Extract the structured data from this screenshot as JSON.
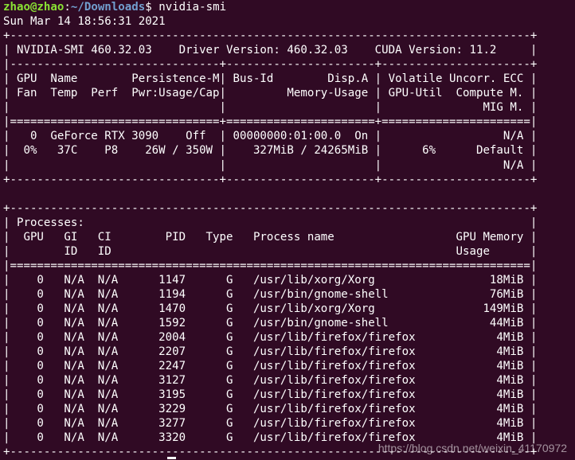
{
  "prompt": {
    "user_host": "zhao@zhao",
    "path": "~/Downloads",
    "symbol": "$",
    "command": "nvidia-smi"
  },
  "timestamp": "Sun Mar 14 18:56:31 2021",
  "output_lines": [
    "+-----------------------------------------------------------------------------+",
    "| NVIDIA-SMI 460.32.03    Driver Version: 460.32.03    CUDA Version: 11.2     |",
    "|-------------------------------+----------------------+----------------------+",
    "| GPU  Name        Persistence-M| Bus-Id        Disp.A | Volatile Uncorr. ECC |",
    "| Fan  Temp  Perf  Pwr:Usage/Cap|         Memory-Usage | GPU-Util  Compute M. |",
    "|                               |                      |               MIG M. |",
    "|===============================+======================+======================|",
    "|   0  GeForce RTX 3090    Off  | 00000000:01:00.0  On |                  N/A |",
    "|  0%   37C    P8    26W / 350W |    327MiB / 24265MiB |      6%      Default |",
    "|                               |                      |                  N/A |",
    "+-------------------------------+----------------------+----------------------+",
    "",
    "+-----------------------------------------------------------------------------+",
    "| Processes:                                                                  |",
    "|  GPU   GI   CI        PID   Type   Process name                  GPU Memory |",
    "|        ID   ID                                                   Usage      |",
    "|=============================================================================|",
    "|    0   N/A  N/A      1147      G   /usr/lib/xorg/Xorg                 18MiB |",
    "|    0   N/A  N/A      1194      G   /usr/bin/gnome-shell               76MiB |",
    "|    0   N/A  N/A      1470      G   /usr/lib/xorg/Xorg                149MiB |",
    "|    0   N/A  N/A      1592      G   /usr/bin/gnome-shell               44MiB |",
    "|    0   N/A  N/A      2004      G   /usr/lib/firefox/firefox            4MiB |",
    "|    0   N/A  N/A      2207      G   /usr/lib/firefox/firefox            4MiB |",
    "|    0   N/A  N/A      2247      G   /usr/lib/firefox/firefox            4MiB |",
    "|    0   N/A  N/A      3127      G   /usr/lib/firefox/firefox            4MiB |",
    "|    0   N/A  N/A      3195      G   /usr/lib/firefox/firefox            4MiB |",
    "|    0   N/A  N/A      3229      G   /usr/lib/firefox/firefox            4MiB |",
    "|    0   N/A  N/A      3277      G   /usr/lib/firefox/firefox            4MiB |",
    "|    0   N/A  N/A      3320      G   /usr/lib/firefox/firefox            4MiB |",
    "+-----------------------------------------------------------------------------+"
  ],
  "watermark": "https://blog.csdn.net/weixin_41170972",
  "colors": {
    "background": "#300a24",
    "prompt_user": "#8ae234",
    "prompt_path": "#729fcf",
    "text": "#ffffff"
  }
}
